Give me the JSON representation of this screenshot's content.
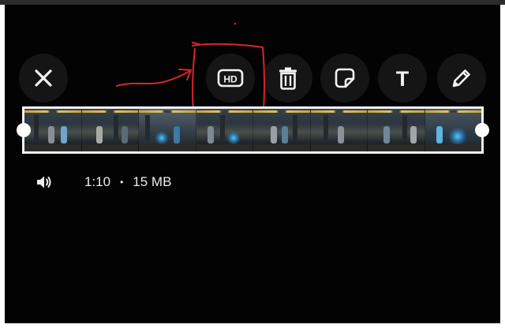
{
  "toolbar": {
    "buttons": [
      {
        "name": "close-button",
        "icon": "close-icon"
      },
      {
        "name": "hd-button",
        "icon": "hd-icon",
        "label": "HD"
      },
      {
        "name": "delete-button",
        "icon": "trash-icon"
      },
      {
        "name": "sticker-button",
        "icon": "sticker-icon"
      },
      {
        "name": "text-button",
        "icon": "text-icon",
        "label": "T"
      },
      {
        "name": "draw-button",
        "icon": "pencil-icon"
      }
    ]
  },
  "video": {
    "duration": "1:10",
    "separator": "•",
    "size": "15 MB",
    "sound_icon": "speaker-icon"
  },
  "colors": {
    "background": "#030303",
    "button_bg": "#151515",
    "icon": "#f2f2f2",
    "annotation": "#d8252a",
    "trim_border": "#f4f4f4"
  }
}
